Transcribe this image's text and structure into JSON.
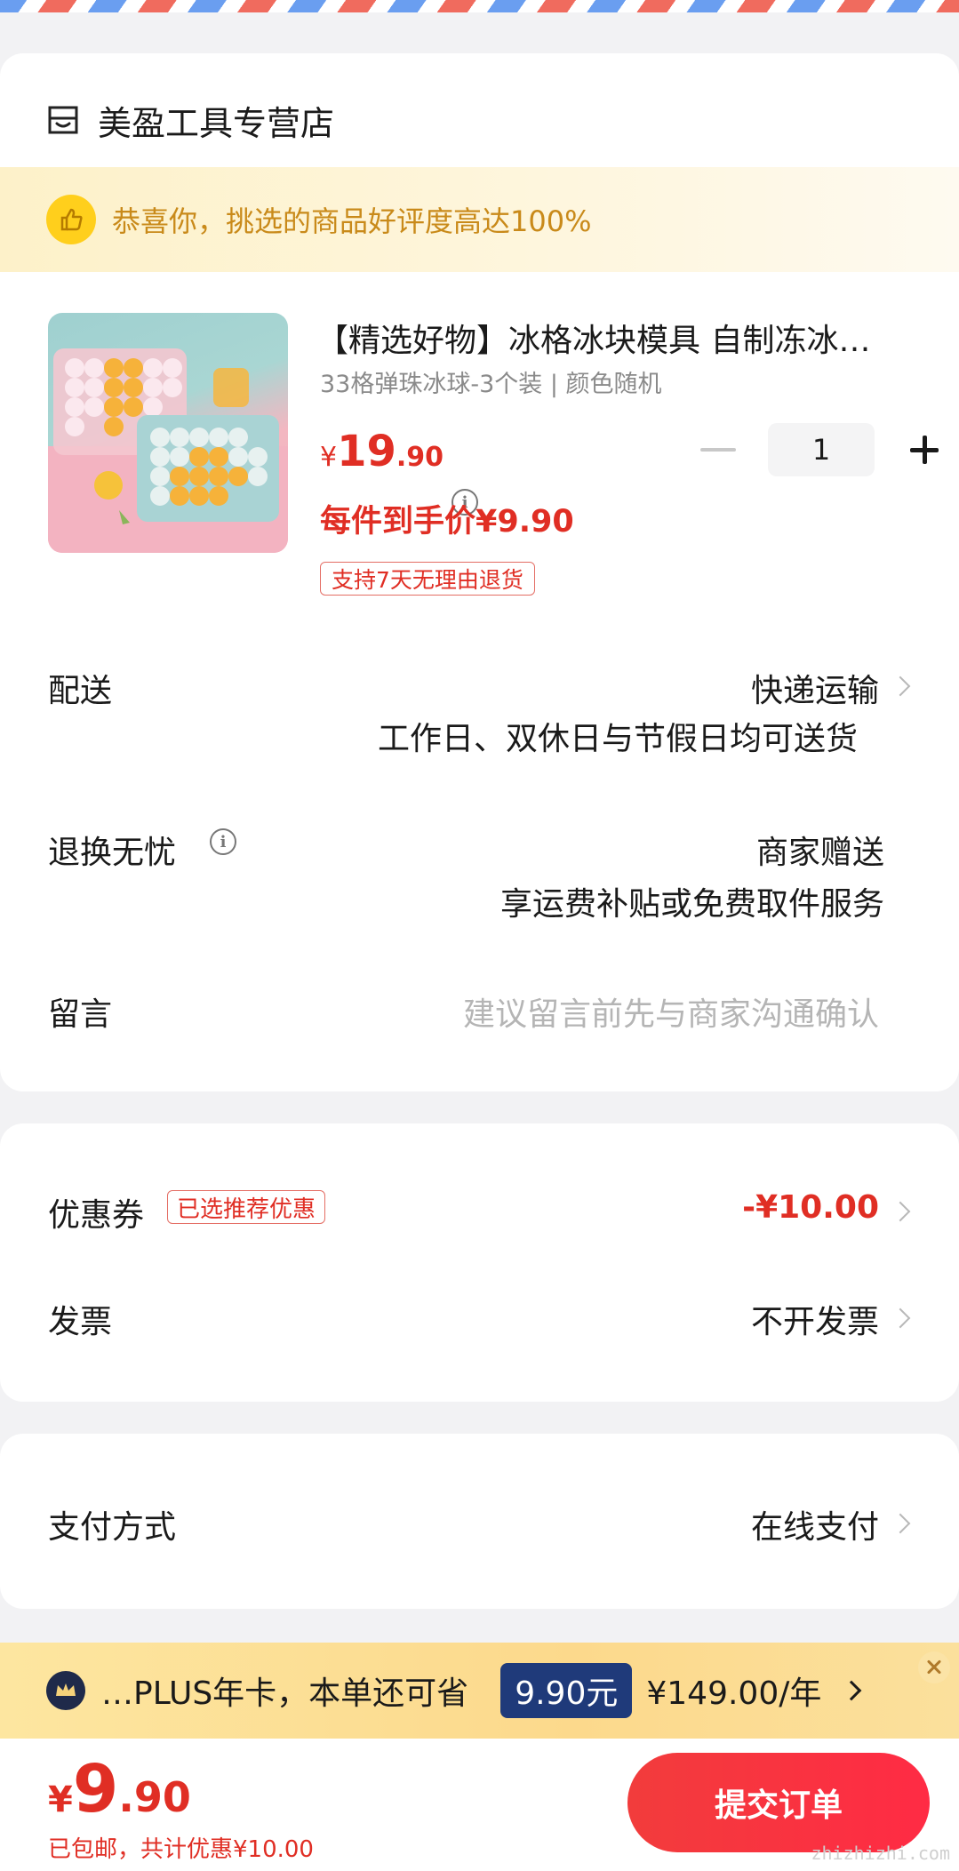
{
  "store": {
    "name": "美盈工具专营店",
    "icon": "store-icon"
  },
  "praise": {
    "text": "恭喜你，挑选的商品好评度高达100%",
    "icon": "thumbs-up-icon"
  },
  "product": {
    "title": "【精选好物】冰格冰块模具 自制冻冰块冰球神器冻冰格",
    "spec": "33格弹珠冰球-3个装 | 颜色随机",
    "price_currency": "¥",
    "price_int": "19",
    "price_dec": ".90",
    "deal_price": "每件到手价¥9.90",
    "return_tag": "支持7天无理由退货",
    "quantity": "1"
  },
  "delivery": {
    "label": "配送",
    "method": "快递运输",
    "note": "工作日、双休日与节假日均可送货"
  },
  "worry_free": {
    "label": "退换无忧",
    "value": "商家赠送",
    "note": "享运费补贴或免费取件服务"
  },
  "message": {
    "label": "留言",
    "placeholder": "建议留言前先与商家沟通确认"
  },
  "coupon": {
    "label": "优惠券",
    "tag": "已选推荐优惠",
    "amount": "-¥10.00"
  },
  "invoice": {
    "label": "发票",
    "value": "不开发票"
  },
  "payment": {
    "label": "支付方式",
    "value": "在线支付"
  },
  "plus": {
    "text": "…PLUS年卡，本单还可省",
    "save": "9.90元",
    "price": "¥149.00/年"
  },
  "footer": {
    "total_currency": "¥",
    "total_int": "9",
    "total_dec": ".90",
    "summary": "已包邮，共计优惠¥10.00",
    "submit_label": "提交订单",
    "watermark": "zhizhizhi.com"
  },
  "colors": {
    "accent": "#e02e24",
    "gold": "#c98a1a",
    "plus_badge": "#1f3a7a"
  }
}
